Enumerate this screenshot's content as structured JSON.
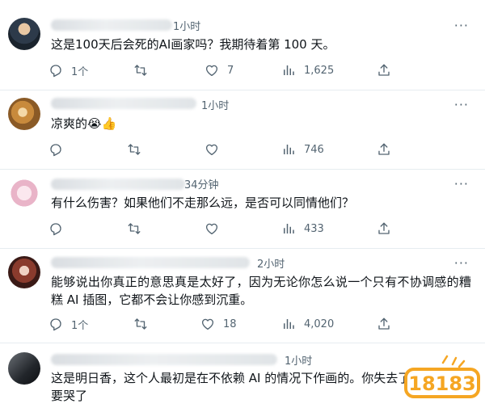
{
  "tweets": [
    {
      "time": "1小时",
      "text": "这是100天后会死的AI画家吗？我期待着第 100 天。",
      "replies": "1个",
      "retweets": "",
      "likes": "7",
      "views": "1,625"
    },
    {
      "time": "1小时",
      "text": "凉爽的😭👍",
      "replies": "",
      "retweets": "",
      "likes": "",
      "views": "746"
    },
    {
      "time": "34分钟",
      "text": "有什么伤害？如果他们不走那么远，是否可以同情他们？",
      "replies": "",
      "retweets": "",
      "likes": "",
      "views": "433"
    },
    {
      "time": "2小时",
      "text_line1": "能够说出你真正的意思真是太好了，因为无论你怎么说一个只有不协调感的糟",
      "text_line2": "糕 AI 插图，它都不会让你感到沉重。",
      "replies": "1个",
      "retweets": "",
      "likes": "18",
      "views": "4,020"
    },
    {
      "time": "1小时",
      "text_line1": "这是明日香，这个人最初是在不依赖 AI 的情况下作画的。你失去了",
      "text_line2": "要哭了"
    }
  ],
  "watermark": "18183",
  "icons": {
    "reply": "reply-icon",
    "retweet": "retweet-icon",
    "like": "heart-icon",
    "views": "views-icon",
    "share": "share-icon",
    "more": "more-icon"
  },
  "colors": {
    "icon": "#536471",
    "divider": "#e6ecf0",
    "watermark": "#f5a623"
  }
}
